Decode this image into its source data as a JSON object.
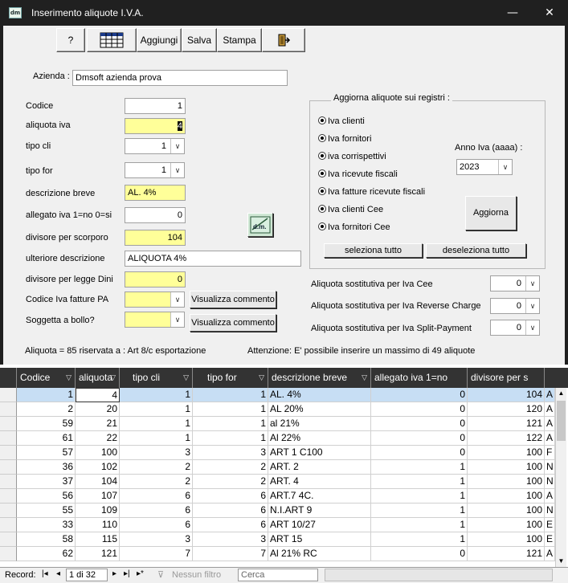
{
  "window": {
    "title": "Inserimento aliquote I.V.A.",
    "app_icon_text": "dm",
    "minimize": "—",
    "maximize": "☐",
    "close": "✕"
  },
  "toolbar": {
    "help": "?",
    "grid_icon": "grid-icon",
    "add": "Aggiungi",
    "save": "Salva",
    "print": "Stampa",
    "exit_icon": "exit-door-icon"
  },
  "company": {
    "label": "Azienda :",
    "value": "Dmsoft azienda prova"
  },
  "fields": {
    "codice": {
      "label": "Codice",
      "value": "1"
    },
    "aliquota": {
      "label": "aliquota iva",
      "value": "4"
    },
    "tipo_cli": {
      "label": "tipo cli",
      "value": "1"
    },
    "tipo_for": {
      "label": "tipo for",
      "value": "1"
    },
    "descr_breve": {
      "label": "descrizione breve",
      "value": "AL. 4%"
    },
    "allegato": {
      "label": "allegato iva 1=no 0=si",
      "value": "0"
    },
    "divisore": {
      "label": "divisore per scorporo",
      "value": "104"
    },
    "ulteriore": {
      "label": "ulteriore descrizione",
      "value": "ALIQUOTA 4%"
    },
    "dini": {
      "label": "divisore per legge Dini",
      "value": "0"
    },
    "codice_pa": {
      "label": "Codice Iva fatture PA",
      "value": ""
    },
    "bollo": {
      "label": "Soggetta a bollo?",
      "value": ""
    }
  },
  "buttons": {
    "visualizza1": "Visualizza commento",
    "visualizza2": "Visualizza commento",
    "seleziona": "seleziona tutto",
    "deseleziona": "deseleziona tutto",
    "aggiorna": "Aggiorna",
    "logo_text": "d.m."
  },
  "registri": {
    "title": "Aggiorna aliquote sui registri :",
    "items": [
      "Iva clienti",
      "Iva fornitori",
      "iva corrispettivi",
      "Iva ricevute fiscali",
      "Iva fatture ricevute fiscali",
      "Iva clienti Cee",
      "Iva fornitori Cee"
    ],
    "anno_label": "Anno Iva  (aaaa) :",
    "anno_value": "2023"
  },
  "sostitutive": [
    {
      "label": "Aliquota sostitutiva  per Iva Cee",
      "value": "0"
    },
    {
      "label": "Aliquota sostitutiva  per Iva Reverse Charge",
      "value": "0"
    },
    {
      "label": "Aliquota sostitutiva  per Iva Split-Payment",
      "value": "0"
    }
  ],
  "footer_notes": {
    "left": "Aliquota = 85 riservata a : Art 8/c esportazione",
    "right": "Attenzione: E' possibile inserire un massimo di 49 aliquote"
  },
  "table": {
    "headers": [
      "Codice",
      "aliquota",
      "tipo cli",
      "tipo for",
      "descrizione breve",
      "allegato iva 1=no",
      "divisore per s",
      ""
    ],
    "rows": [
      [
        "1",
        "4",
        "1",
        "1",
        "AL. 4%",
        "0",
        "104",
        "A"
      ],
      [
        "2",
        "20",
        "1",
        "1",
        "AL 20%",
        "0",
        "120",
        "A"
      ],
      [
        "59",
        "21",
        "1",
        "1",
        "al 21%",
        "0",
        "121",
        "A"
      ],
      [
        "61",
        "22",
        "1",
        "1",
        "Al 22%",
        "0",
        "122",
        "A"
      ],
      [
        "57",
        "100",
        "3",
        "3",
        "ART 1 C100",
        "0",
        "100",
        "F"
      ],
      [
        "36",
        "102",
        "2",
        "2",
        "ART. 2",
        "1",
        "100",
        "N"
      ],
      [
        "37",
        "104",
        "2",
        "2",
        "ART. 4",
        "1",
        "100",
        "N"
      ],
      [
        "56",
        "107",
        "6",
        "6",
        "ART.7 4C.",
        "1",
        "100",
        "A"
      ],
      [
        "55",
        "109",
        "6",
        "6",
        "N.I.ART 9",
        "1",
        "100",
        "N"
      ],
      [
        "33",
        "110",
        "6",
        "6",
        "ART 10/27",
        "1",
        "100",
        "E"
      ],
      [
        "58",
        "115",
        "3",
        "3",
        "ART 15",
        "1",
        "100",
        "E"
      ],
      [
        "62",
        "121",
        "7",
        "7",
        "Al 21% RC",
        "0",
        "121",
        "A"
      ]
    ]
  },
  "status": {
    "record_label": "Record:",
    "position": "1 di 32",
    "filter": "Nessun filtro",
    "search": "Cerca"
  }
}
